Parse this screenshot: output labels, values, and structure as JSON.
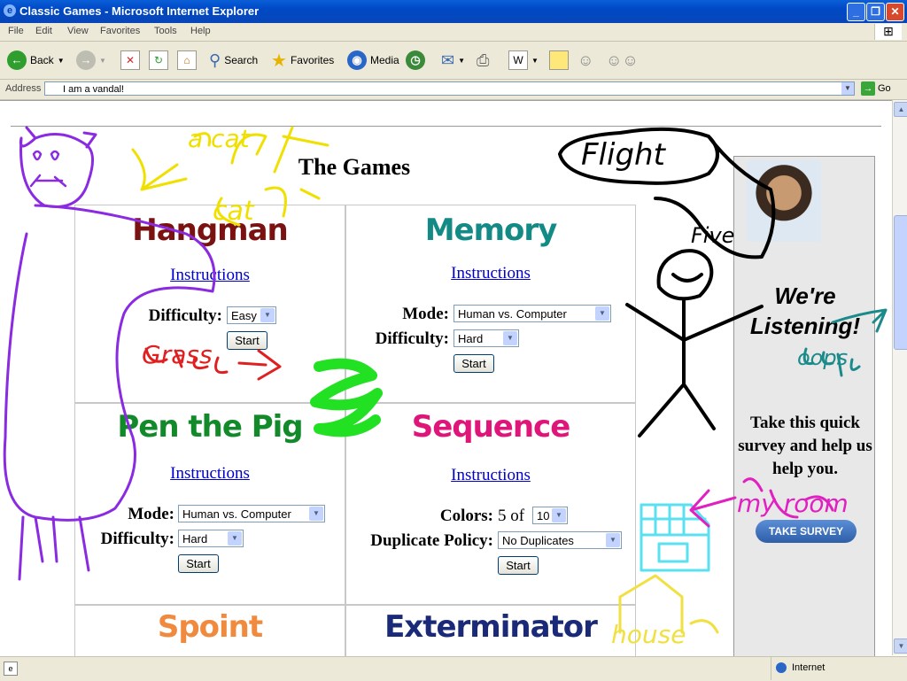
{
  "window": {
    "title": "Classic Games - Microsoft Internet Explorer",
    "controls": {
      "minimize": "_",
      "maximize": "❐",
      "close": "✕"
    }
  },
  "menu": [
    "File",
    "Edit",
    "View",
    "Favorites",
    "Tools",
    "Help"
  ],
  "toolbar": {
    "back": "Back",
    "search": "Search",
    "favorites": "Favorites",
    "media": "Media"
  },
  "address": {
    "label": "Address",
    "value": "I am a vandal!",
    "go": "Go"
  },
  "page": {
    "heading": "The Games",
    "instructions_label": "Instructions",
    "start_label": "Start",
    "games": {
      "hangman": {
        "title": "Hangman",
        "title_color": "#7a1212",
        "difficulty_label": "Difficulty:",
        "difficulty": "Easy"
      },
      "memory": {
        "title": "Memory",
        "title_color": "#138a86",
        "mode_label": "Mode:",
        "mode": "Human vs. Computer",
        "difficulty_label": "Difficulty:",
        "difficulty": "Hard"
      },
      "pen_the_pig": {
        "title": "Pen the Pig",
        "title_color": "#138a2a",
        "mode_label": "Mode:",
        "mode": "Human vs. Computer",
        "difficulty_label": "Difficulty:",
        "difficulty": "Hard"
      },
      "sequence": {
        "title": "Sequence",
        "title_color": "#e0157a",
        "colors_label": "Colors:",
        "colors_of_text": "5 of",
        "colors": "10",
        "duplicate_label": "Duplicate Policy:",
        "duplicate": "No Duplicates"
      },
      "spoint": {
        "title": "Spoint",
        "title_color": "#f08a3e"
      },
      "exterminator": {
        "title": "Exterminator",
        "title_color": "#1a2a78"
      }
    }
  },
  "ad": {
    "headline": "We're Listening!",
    "body": "Take this quick survey and help us help you.",
    "button": "TAKE SURVEY"
  },
  "doodles": {
    "kite": "Flight",
    "kite_two": "Five",
    "a_cat": "a cat",
    "cat": "cat",
    "grass": "Grass",
    "oops": "oops",
    "my_room": "my room",
    "house": "house"
  },
  "status": {
    "zone": "Internet"
  },
  "colors": {
    "titlebar": "#0a5fd8",
    "chrome": "#ece9d8",
    "link": "#0000cc"
  }
}
